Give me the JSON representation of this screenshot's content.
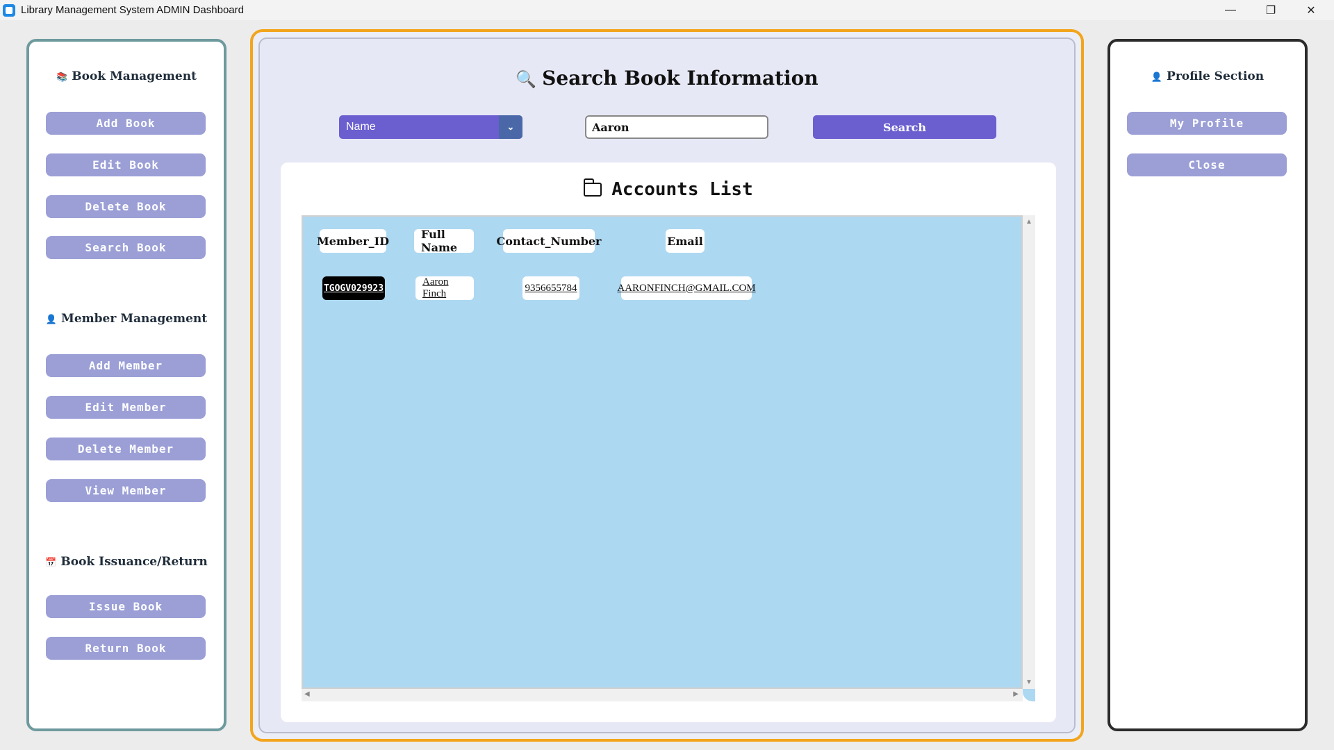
{
  "window": {
    "title": "Library Management System ADMIN Dashboard",
    "controls": {
      "minimize": "—",
      "restore": "❐",
      "close": "✕"
    }
  },
  "left_panel": {
    "book_management": {
      "heading": "Book Management",
      "icon": "📚",
      "buttons": [
        "Add Book",
        "Edit Book",
        "Delete Book",
        "Search Book"
      ]
    },
    "member_management": {
      "heading": "Member Management",
      "icon": "👤",
      "buttons": [
        "Add Member",
        "Edit Member",
        "Delete Member",
        "View Member"
      ]
    },
    "issuance": {
      "heading": "Book Issuance/Return",
      "icon": "📅",
      "buttons": [
        "Issue Book",
        "Return Book"
      ]
    }
  },
  "center": {
    "title": "Search Book Information",
    "title_icon": "🔍",
    "search_by": {
      "selected": "Name"
    },
    "search_input": {
      "value": "Aaron"
    },
    "search_button": "Search",
    "accounts": {
      "title": "Accounts List",
      "headers": [
        "Member_ID",
        "Full Name",
        "Contact_Number",
        "Email"
      ],
      "rows": [
        {
          "member_id": "TGOGV029923",
          "full_name": "Aaron Finch",
          "contact": "9356655784",
          "email": "AARONFINCH@GMAIL.COM"
        }
      ]
    }
  },
  "right_panel": {
    "heading": "Profile Section",
    "icon": "👤",
    "buttons": [
      "My Profile",
      "Close"
    ]
  },
  "colors": {
    "left_border": "#6e9a9e",
    "center_border": "#f2a51c",
    "right_border": "#2b2b2b",
    "side_button": "#9b9fd6",
    "accent": "#6b5fd0",
    "table_bg": "#add8f1"
  }
}
